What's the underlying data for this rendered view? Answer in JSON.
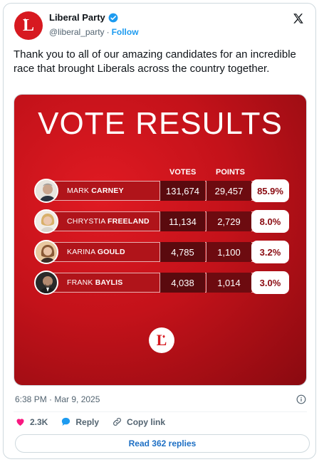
{
  "account": {
    "display_name": "Liberal Party",
    "handle": "@liberal_party",
    "separator": "·",
    "follow_label": "Follow",
    "avatar_letter": "L"
  },
  "tweet": {
    "text": "Thank you to all of our amazing candidates for an incredible race that brought Liberals across the country together.",
    "timestamp": "6:38 PM · Mar 9, 2025"
  },
  "media": {
    "title": "VOTE RESULTS",
    "col_votes": "VOTES",
    "col_points": "POINTS",
    "logo_letter": "L",
    "rows": [
      {
        "first": "MARK",
        "last": "CARNEY",
        "votes": "131,674",
        "points": "29,457",
        "pct": "85.9%"
      },
      {
        "first": "CHRYSTIA",
        "last": "FREELAND",
        "votes": "11,134",
        "points": "2,729",
        "pct": "8.0%"
      },
      {
        "first": "KARINA",
        "last": "GOULD",
        "votes": "4,785",
        "points": "1,100",
        "pct": "3.2%"
      },
      {
        "first": "FRANK",
        "last": "BAYLIS",
        "votes": "4,038",
        "points": "1,014",
        "pct": "3.0%"
      }
    ]
  },
  "actions": {
    "likes": "2.3K",
    "reply_label": "Reply",
    "copy_label": "Copy link",
    "read_replies": "Read 362 replies"
  },
  "colors": {
    "brand_red": "#d71920",
    "link_blue": "#1d9bf0",
    "like_pink": "#f91880"
  }
}
